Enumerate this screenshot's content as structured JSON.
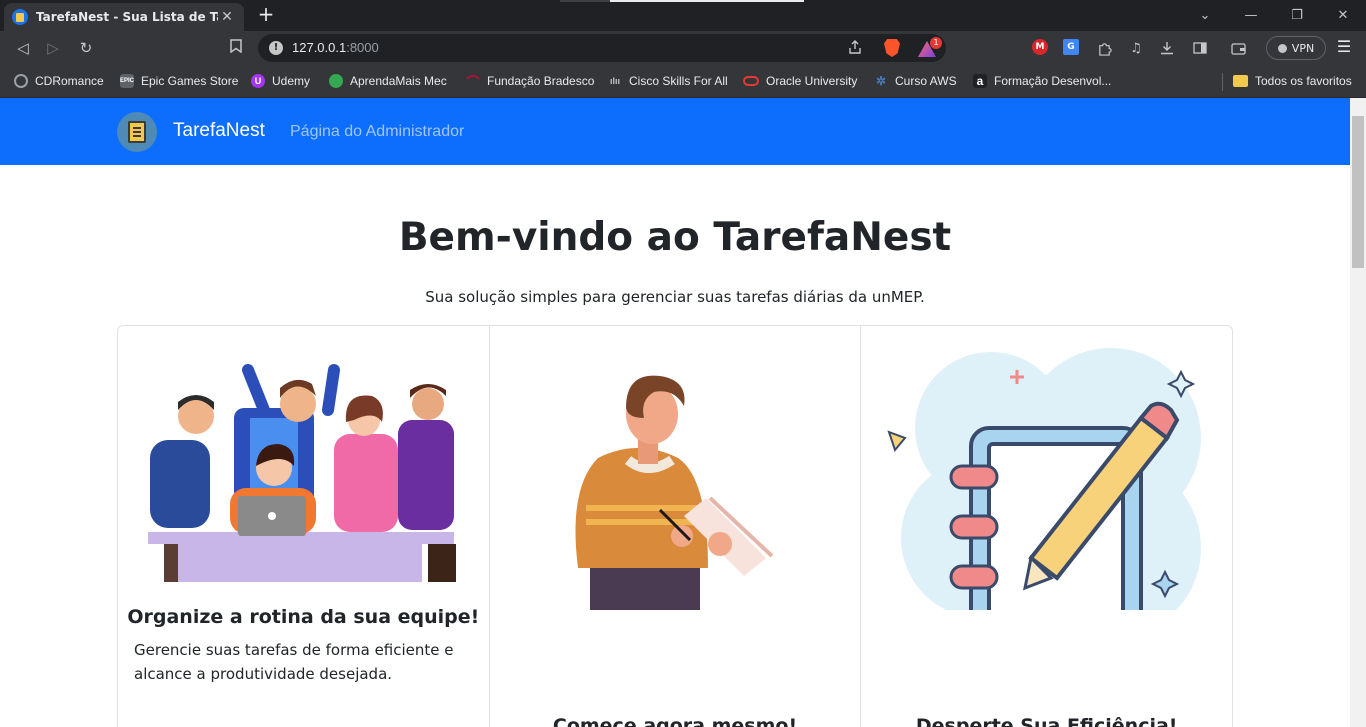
{
  "browser": {
    "tab_title": "TarefaNest - Sua Lista de Tarefas",
    "close_glyph": "✕",
    "new_tab_glyph": "+",
    "url_host": "127.0.0.1",
    "url_port": ":8000",
    "badge_count": "1",
    "vpn_label": "VPN",
    "window_controls": [
      "⌄",
      "—",
      "❐",
      "✕"
    ]
  },
  "bookmarks": [
    {
      "label": "CDRomance",
      "icon": "disc-icon",
      "color": "#9aa0a6"
    },
    {
      "label": "Epic Games Store",
      "icon": "epic-icon",
      "color": "#5f6368"
    },
    {
      "label": "Udemy",
      "icon": "udemy-icon",
      "color": "#a435f0"
    },
    {
      "label": "AprendaMais Mec",
      "icon": "mec-icon",
      "color": "#34a853"
    },
    {
      "label": "Fundação Bradesco",
      "icon": "bradesco-icon",
      "color": "#cc092f"
    },
    {
      "label": "Cisco Skills For All",
      "icon": "cisco-icon",
      "color": "#9aa0a6"
    },
    {
      "label": "Oracle University",
      "icon": "oracle-icon",
      "color": "#e53935"
    },
    {
      "label": "Curso AWS",
      "icon": "aws-icon",
      "color": "#4a7ab8"
    },
    {
      "label": "Formação Desenvol...",
      "icon": "alura-icon",
      "color": "#202124"
    }
  ],
  "all_bookmarks_label": "Todos os favoritos",
  "site": {
    "brand": "TarefaNest",
    "nav_link": "Página do Administrador",
    "hero_title": "Bem-vindo ao TarefaNest",
    "hero_subtitle": "Sua solução simples para gerenciar suas tarefas diárias da unMEP."
  },
  "cards": [
    {
      "title": "Organize a rotina da sua equipe!",
      "text": "Gerencie suas tarefas de forma eficiente e alcance a produtividade desejada.",
      "illustration": "team-illustration"
    },
    {
      "title": "Comece agora mesmo!",
      "text": "",
      "illustration": "person-writing-illustration"
    },
    {
      "title": "Desperte Sua Eficiência!",
      "text": "",
      "illustration": "notebook-pencil-illustration"
    }
  ],
  "colors": {
    "navbar": "#0d6efd",
    "chrome_dark": "#202124",
    "chrome_mid": "#35363a"
  }
}
